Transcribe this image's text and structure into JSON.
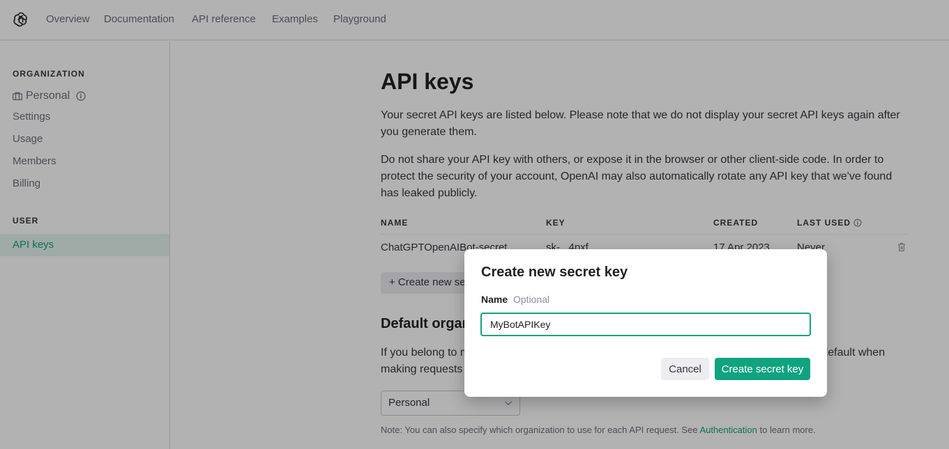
{
  "nav": {
    "links": [
      "Overview",
      "Documentation",
      "API reference",
      "Examples",
      "Playground"
    ]
  },
  "sidebar": {
    "org_heading": "ORGANIZATION",
    "org_name": "Personal",
    "org_items": [
      "Settings",
      "Usage",
      "Members",
      "Billing"
    ],
    "user_heading": "USER",
    "active_item": "API keys"
  },
  "page": {
    "title": "API keys",
    "intro": "Your secret API keys are listed below. Please note that we do not display your secret API keys again after you generate them.",
    "warning": "Do not share your API key with others, or expose it in the browser or other client-side code. In order to protect the security of your account, OpenAI may also automatically rotate any API key that we've found has leaked publicly.",
    "table": {
      "headers": [
        "NAME",
        "KEY",
        "CREATED",
        "LAST USED"
      ],
      "rows": [
        {
          "name": "ChatGPTOpenAIBot-secret",
          "key": "sk-...4pxf",
          "created": "17 Apr 2023",
          "last_used": "Never"
        }
      ]
    },
    "create_button": "+ Create new secret key",
    "default_org_title": "Default organization",
    "default_org_text": "If you belong to multiple organizations, this setting controls which organization is used by default when making requests with the API keys above.",
    "org_select_value": "Personal",
    "note_prefix": "Note: You can also specify which organization to use for each API request. See ",
    "note_link": "Authentication",
    "note_suffix": " to learn more."
  },
  "modal": {
    "title": "Create new secret key",
    "field_label": "Name",
    "field_hint": "Optional",
    "field_value": "MyBotAPIKey",
    "cancel_label": "Cancel",
    "submit_label": "Create secret key"
  },
  "colors": {
    "accent": "#10a37f",
    "text": "#353740",
    "muted": "#6e6e80",
    "active_bg": "#e6f4ef"
  },
  "icons": [
    "openai-logo-icon",
    "briefcase-icon",
    "info-icon",
    "trash-icon",
    "chevron-down-icon"
  ]
}
